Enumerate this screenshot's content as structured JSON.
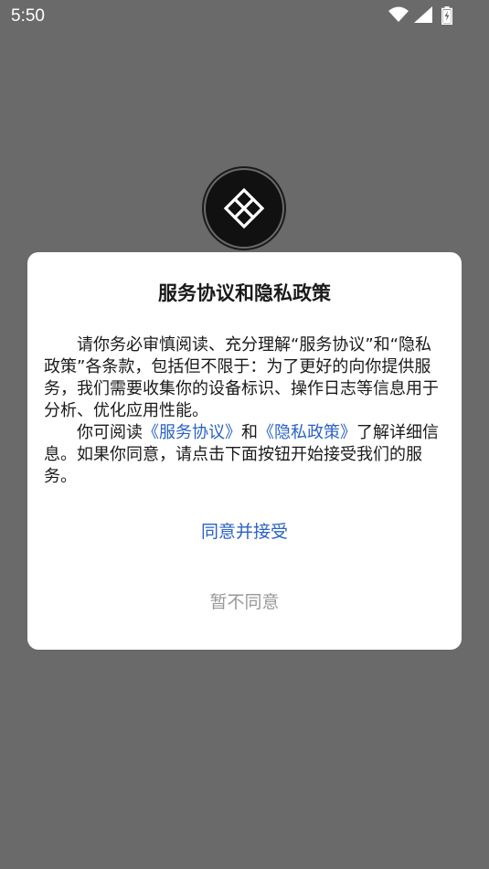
{
  "status_bar": {
    "time": "5:50",
    "icons": [
      "wifi-icon",
      "cellular-signal-icon",
      "battery-charging-icon"
    ]
  },
  "logo": {
    "icon": "diamond-logo-icon",
    "colors": {
      "ring": "#1a1a1a",
      "mark": "#ffffff"
    }
  },
  "dialog": {
    "title": "服务协议和隐私政策",
    "paragraph1": "请你务必审慎阅读、充分理解“服务协议”和“隐私政策”各条款，包括但不限于：为了更好的向你提供服务，我们需要收集你的设备标识、操作日志等信息用于分析、优化应用性能。",
    "paragraph2_prefix": "你可阅读",
    "service_agreement_link": "《服务协议》",
    "paragraph2_and": "和",
    "privacy_policy_link": "《隐私政策》",
    "paragraph2_suffix": "了解详细信息。如果你同意，请点击下面按钮开始接受我们的服务。",
    "accept_label": "同意并接受",
    "decline_label": "暂不同意"
  },
  "colors": {
    "overlay": "#6a6a6a",
    "link": "#2a62c8",
    "decline_text": "#999999"
  }
}
